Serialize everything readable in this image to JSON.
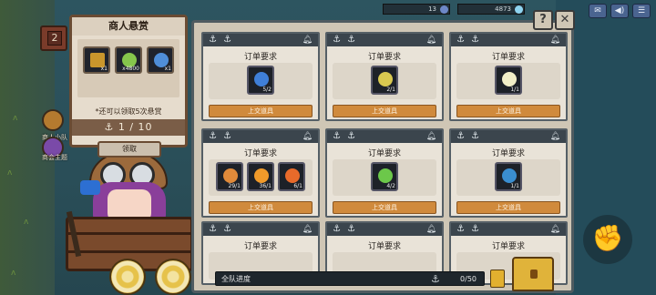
{
  "topbar": {
    "resources": [
      {
        "value": "13",
        "color": "#6e88c8"
      },
      {
        "value": "4873",
        "color": "#8fd4f0"
      }
    ],
    "buttons": [
      {
        "name": "mail-button",
        "glyph": "✉"
      },
      {
        "name": "sound-button",
        "glyph": "◀)"
      },
      {
        "name": "menu-button",
        "glyph": "☰"
      }
    ]
  },
  "left": {
    "house_badge": "2",
    "side_items": [
      {
        "label": "商人小队",
        "color": "#b57a2f"
      },
      {
        "label": "商会主题",
        "color": "#7a4aa8"
      }
    ]
  },
  "bounty": {
    "title": "商人悬赏",
    "rewards": [
      {
        "icon": "chest-icon",
        "qty": "x1",
        "color": "#c9962c"
      },
      {
        "icon": "gem-cluster-icon",
        "qty": "x4800",
        "color": "#86c64c"
      },
      {
        "icon": "crystal-icon",
        "qty": "x1",
        "color": "#4f8ed8"
      }
    ],
    "note": "*还可以领取5次悬赏",
    "counter": "1 / 10",
    "claim_label": "领取"
  },
  "board": {
    "help_label": "?",
    "close_label": "✕",
    "orders": [
      {
        "title": "订单要求",
        "submit": "上交道具",
        "items": [
          {
            "icon": "blue-gem-icon",
            "color": "#3f7fd8",
            "qty": "5/2"
          }
        ]
      },
      {
        "title": "订单要求",
        "submit": "上交道具",
        "items": [
          {
            "icon": "seed-cluster-icon",
            "color": "#d8c850",
            "qty": "2/1"
          }
        ]
      },
      {
        "title": "订单要求",
        "submit": "上交道具",
        "items": [
          {
            "icon": "pearl-icon",
            "color": "#f2efc8",
            "qty": "1/1"
          }
        ]
      },
      {
        "title": "订单要求",
        "submit": "上交道具",
        "items": [
          {
            "icon": "shrimp-icon",
            "color": "#e08a3a",
            "qty": "29/1"
          },
          {
            "icon": "goldfish-icon",
            "color": "#f09a2a",
            "qty": "36/1"
          },
          {
            "icon": "koi-icon",
            "color": "#e86a2a",
            "qty": "6/1"
          }
        ]
      },
      {
        "title": "订单要求",
        "submit": "上交道具",
        "items": [
          {
            "icon": "green-shell-icon",
            "color": "#6cc84a",
            "qty": "4/2"
          }
        ]
      },
      {
        "title": "订单要求",
        "submit": "上交道具",
        "items": [
          {
            "icon": "blue-fish-icon",
            "color": "#3a8ed0",
            "qty": "1/1"
          }
        ]
      },
      {
        "title": "订单要求",
        "submit": "",
        "items": []
      },
      {
        "title": "订单要求",
        "submit": "",
        "items": []
      },
      {
        "title": "订单要求",
        "submit": "",
        "items": []
      }
    ]
  },
  "progress": {
    "label": "全队进度",
    "value": "0/50",
    "fraction": 0
  }
}
